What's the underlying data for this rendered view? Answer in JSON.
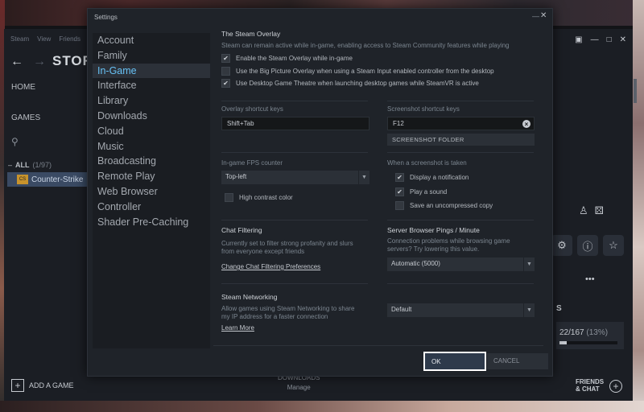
{
  "steam": {
    "menu": [
      "Steam",
      "View",
      "Friends"
    ],
    "store_title": "STOR",
    "home": "HOME",
    "games": "GAMES",
    "all_label": "ALL",
    "all_count": "(1/97)",
    "selected_game": "Counter-Strike",
    "add_game": "ADD A GAME",
    "downloads": "DOWNLOADS",
    "downloads_sub": "Manage",
    "friends_line1": "FRIENDS",
    "friends_line2": "& CHAT",
    "achievements_letter": "S",
    "achievements": "22/167",
    "achievements_pct": "(13%)",
    "achievements_progress": 0.13,
    "dots": "•••"
  },
  "dialog": {
    "title": "Settings",
    "nav": [
      "Account",
      "Family",
      "In-Game",
      "Interface",
      "Library",
      "Downloads",
      "Cloud",
      "Music",
      "Broadcasting",
      "Remote Play",
      "Web Browser",
      "Controller",
      "Shader Pre-Caching"
    ],
    "active_nav": "In-Game",
    "overlay": {
      "heading": "The Steam Overlay",
      "desc": "Steam can remain active while in-game, enabling access to Steam Community features while playing",
      "options": [
        {
          "label": "Enable the Steam Overlay while in-game",
          "checked": true
        },
        {
          "label": "Use the Big Picture Overlay when using a Steam Input enabled controller from the desktop",
          "checked": false
        },
        {
          "label": "Use Desktop Game Theatre when launching desktop games while SteamVR is active",
          "checked": true
        }
      ]
    },
    "overlay_keys": {
      "label": "Overlay shortcut keys",
      "value": "Shift+Tab"
    },
    "screenshot_keys": {
      "label": "Screenshot shortcut keys",
      "value": "F12",
      "folder_button": "SCREENSHOT FOLDER"
    },
    "fps": {
      "label": "In-game FPS counter",
      "value": "Top-left",
      "high_contrast": "High contrast color",
      "high_contrast_checked": false
    },
    "screenshot_taken": {
      "label": "When a screenshot is taken",
      "options": [
        {
          "label": "Display a notification",
          "checked": true
        },
        {
          "label": "Play a sound",
          "checked": true
        },
        {
          "label": "Save an uncompressed copy",
          "checked": false
        }
      ]
    },
    "chat_filter": {
      "heading": "Chat Filtering",
      "desc1": "Currently set to filter strong profanity and slurs",
      "desc2": "from everyone except friends",
      "link": "Change Chat Filtering Preferences"
    },
    "pings": {
      "heading": "Server Browser Pings / Minute",
      "desc1": "Connection problems while browsing game",
      "desc2": "servers?  Try lowering this value.",
      "value": "Automatic (5000)"
    },
    "networking": {
      "heading": "Steam Networking",
      "desc1": "Allow games using Steam Networking to share",
      "desc2": "my IP address for a faster connection",
      "link": "Learn More",
      "value": "Default"
    },
    "ok": "OK",
    "cancel": "CANCEL"
  }
}
